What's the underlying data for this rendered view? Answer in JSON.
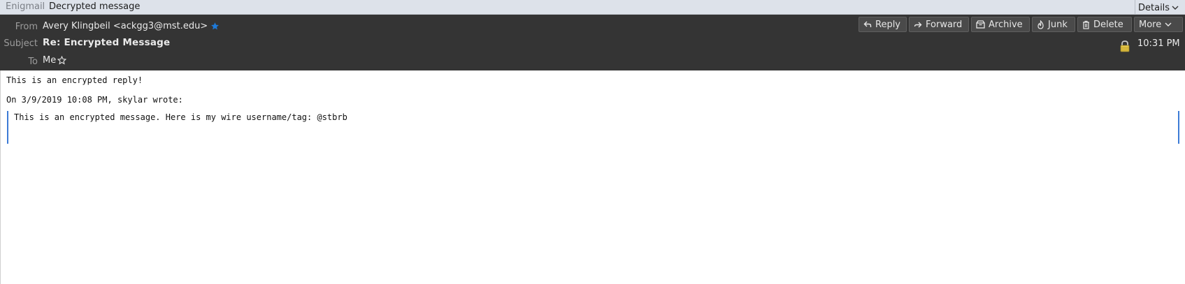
{
  "enigmail": {
    "label": "Enigmail",
    "status": "Decrypted message",
    "details_label": "Details"
  },
  "header": {
    "from_label": "From",
    "from_value": "Avery Klingbeil <ackgg3@mst.edu>",
    "subject_label": "Subject",
    "subject_value": "Re: Encrypted Message",
    "to_label": "To",
    "to_value": "Me",
    "time": "10:31 PM",
    "icons": {
      "from_star": "star-filled-icon",
      "to_star": "star-outline-icon",
      "security": "lock-icon"
    }
  },
  "toolbar": {
    "reply": "Reply",
    "forward": "Forward",
    "archive": "Archive",
    "junk": "Junk",
    "delete": "Delete",
    "more": "More"
  },
  "message": {
    "reply_text": "This is an encrypted reply!",
    "attribution": "On 3/9/2019 10:08 PM, skylar wrote:",
    "quoted_text": "This is an encrypted message. Here is my wire username/tag: @stbrb"
  },
  "colors": {
    "header_bg": "#343434",
    "enigmail_bar_bg": "#dde2ea",
    "quote_border": "#3d7bd6",
    "star_blue": "#1e7ad9"
  }
}
